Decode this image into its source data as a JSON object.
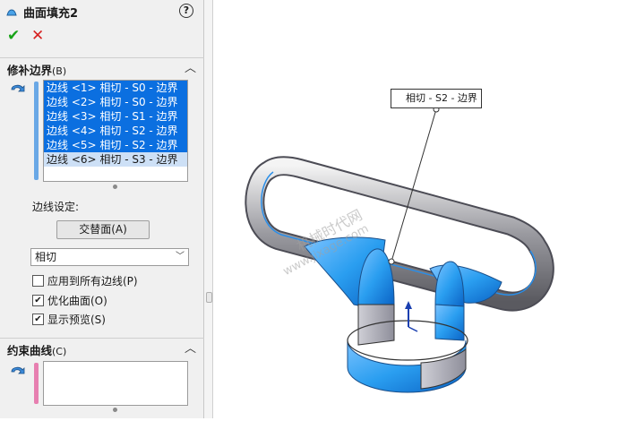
{
  "panel": {
    "title": "曲面填充2",
    "help_label": "?",
    "ok_label": "✔",
    "cancel_label": "✕",
    "patch_section": {
      "title": "修补边界",
      "shortcut": "(B)",
      "edges": [
        "边线 <1> 相切 - S0 - 边界",
        "边线 <2> 相切 - S0 - 边界",
        "边线 <3> 相切 - S1 - 边界",
        "边线 <4> 相切 - S2 - 边界",
        "边线 <5> 相切 - S2 - 边界",
        "边线 <6> 相切 - S3 - 边界"
      ],
      "edge_settings_label": "边线设定:",
      "alternate_face_button": "交替面(A)",
      "condition_value": "相切",
      "apply_all_label": "应用到所有边线(P)",
      "optimize_label": "优化曲面(O)",
      "preview_label": "显示预览(S)",
      "apply_all_checked": false,
      "optimize_checked": true,
      "preview_checked": true
    },
    "constraint_section": {
      "title": "约束曲线",
      "shortcut": "(C)"
    }
  },
  "viewport": {
    "callout_text": "相切 - S2 - 边界",
    "watermark_line1": "机械时代网",
    "watermark_line2": "www.jixage.com"
  },
  "colors": {
    "selection_blue": "#0b6fe0",
    "ok_green": "#17a317",
    "cancel_red": "#d62020",
    "surface_blue": "#2a9ef0"
  }
}
